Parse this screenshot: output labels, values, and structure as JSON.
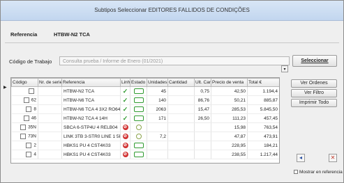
{
  "window": {
    "title": "Subtipos Seleccionar EDITORES FALLIDOS DE CONDIÇÕES"
  },
  "reference": {
    "label": "Referencia",
    "value": "HTBW-N2 TCA"
  },
  "codigo": {
    "label": "Código de Trabajo",
    "placeholder": "Consulta prueba / Informe de Enero (01/2021)"
  },
  "buttons": {
    "seleccionar": "Seleccionar",
    "actualizar": "Ver Ordenes",
    "tipo": "Ver Filtro",
    "ver_todo": "Imprimir Todo"
  },
  "columns": [
    "Código",
    "Nr. de serie",
    "Referencia",
    "Linha",
    "Estado",
    "Unidades",
    "Cantidad",
    "Ult. Cant.",
    "Precio de venta",
    "Total €"
  ],
  "rows": [
    {
      "codigo": "",
      "serie": "",
      "referencia": "HTBW-N2 TCA",
      "linha": "tick",
      "estado": "box",
      "unidades": "45",
      "cantidad": "",
      "ult": "0,75",
      "precio": "42,50",
      "total": "1.194,4"
    },
    {
      "codigo": "62",
      "serie": "",
      "referencia": "HTBW-N6 TCA",
      "linha": "tick",
      "estado": "box",
      "unidades": "140",
      "cantidad": "",
      "ult": "86,76",
      "precio": "50,21",
      "total": "885,87"
    },
    {
      "codigo": "8",
      "serie": "",
      "referencia": "HTBW-N6 TCA 4 3X2 RO64",
      "linha": "tick",
      "estado": "box",
      "unidades": "2063",
      "cantidad": "",
      "ult": "15,47",
      "precio": "285,53",
      "total": "5.845,50"
    },
    {
      "codigo": "46",
      "serie": "",
      "referencia": "HTBW-N2 TCA 4 14H",
      "linha": "tick",
      "estado": "box",
      "unidades": "171",
      "cantidad": "",
      "ult": "26,50",
      "precio": "111,23",
      "total": "457,45"
    },
    {
      "codigo": "35N",
      "serie": "",
      "referencia": "SBCA 6-STP4U 4 RELB04",
      "linha": "stop",
      "estado": "circle",
      "unidades": "",
      "cantidad": "",
      "ult": "",
      "precio": "15,98",
      "total": "763,54"
    },
    {
      "codigo": "73N",
      "serie": "",
      "referencia": "LINK 3TB 3-STR0 LINE 1 5P0",
      "linha": "stop",
      "estado": "circle",
      "unidades": "7,2",
      "cantidad": "",
      "ult": "",
      "precio": "47,87",
      "total": "473,91"
    },
    {
      "codigo": "2",
      "serie": "",
      "referencia": "HBKS1 PU 4 CST4K03",
      "linha": "stop",
      "estado": "box",
      "unidades": "",
      "cantidad": "",
      "ult": "",
      "precio": "228,95",
      "total": "184,21"
    },
    {
      "codigo": "4",
      "serie": "",
      "referencia": "HBKS1 PU 4 CST4K03",
      "linha": "stop",
      "estado": "box",
      "unidades": "",
      "cantidad": "",
      "ult": "",
      "precio": "238,55",
      "total": "1.217,44"
    }
  ],
  "option": {
    "label": "Mostrar en referencia"
  },
  "colors": {
    "titlebar": "#c8daf1",
    "tick": "#2f9a2f",
    "stop": "#d03030",
    "nav_left": "#2a4fa0",
    "nav_right": "#c23a2a"
  }
}
